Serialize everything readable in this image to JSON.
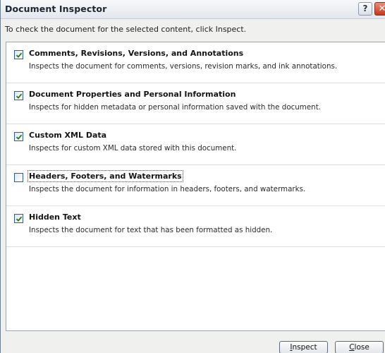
{
  "window": {
    "title": "Document Inspector",
    "help_label": "?",
    "close_label": "✕"
  },
  "instruction": "To check the document for the selected content, click Inspect.",
  "items": [
    {
      "title": "Comments, Revisions, Versions, and Annotations",
      "description": "Inspects the document for comments, versions, revision marks, and ink annotations.",
      "checked": true
    },
    {
      "title": "Document Properties and Personal Information",
      "description": "Inspects for hidden metadata or personal information saved with the document.",
      "checked": true
    },
    {
      "title": "Custom XML Data",
      "description": "Inspects for custom XML data stored with this document.",
      "checked": true
    },
    {
      "title": "Headers, Footers, and Watermarks",
      "description": "Inspects the document for information in headers, footers, and watermarks.",
      "checked": false
    },
    {
      "title": "Hidden Text",
      "description": "Inspects the document for text that has been formatted as hidden.",
      "checked": true
    }
  ],
  "buttons": {
    "inspect_mnemonic": "I",
    "inspect_rest": "nspect",
    "close_mnemonic": "C",
    "close_rest": "lose"
  },
  "colors": {
    "checkmark": "#1f7a1f",
    "title_text": "#1b2533"
  }
}
